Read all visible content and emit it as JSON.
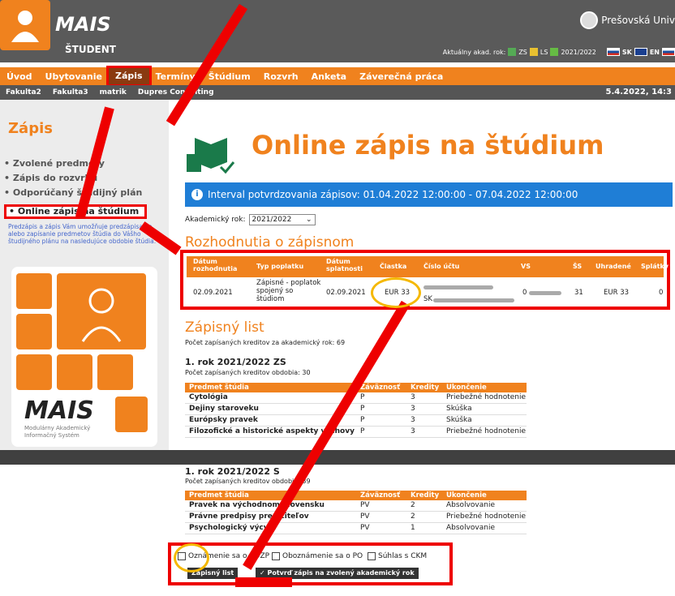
{
  "header": {
    "brand": "MAIS",
    "subbrand": "ŠTUDENT",
    "university": "Prešovská Univ",
    "year_label": "Aktuálny akad. rok:",
    "zs_label": "ZS",
    "ls_label": "LS",
    "year_value": "2021/2022",
    "lang_sk": "SK",
    "lang_en": "EN"
  },
  "menu": [
    "Úvod",
    "Ubytovanie",
    "Zápis",
    "Termíny",
    "Štúdium",
    "Rozvrh",
    "Anketa",
    "Záverečná práca"
  ],
  "active_menu": "Zápis",
  "submenu": [
    "Fakulta2",
    "Fakulta3",
    "matrik",
    "Dupres Consulting"
  ],
  "datetime": "5.4.2022, 14:3",
  "sidebar": {
    "title": "Zápis",
    "links": [
      "• Zvolené predmety",
      "• Zápis do rozvrhu",
      "• Odporúčaný študijný plán"
    ],
    "active": "• Online zápis na štúdium",
    "description": "Predzápis a zápis Vám umožňuje predzápisanie alebo zapísanie predmetov štúdia do Vášho študijného plánu na nasledujúce obdobie štúdia.",
    "logo_text": "MAIS",
    "logo_sub": "Modulárny Akademický Informačný Systém"
  },
  "page": {
    "title": "Online zápis na štúdium",
    "info": "Interval potvrdzovania zápisov: 01.04.2022 12:00:00 - 07.04.2022 12:00:00",
    "year_label": "Akademický rok:",
    "year_value": "2021/2022",
    "decisions_title": "Rozhodnutia o zápisnom",
    "list_title": "Zápisný list",
    "credits_total": "Počet zapísaných kreditov za akademický rok: 69"
  },
  "fees": {
    "headers": [
      "Dátum rozhodnutia",
      "Typ poplatku",
      "Dátum splatnosti",
      "Čiastka",
      "Číslo účtu",
      "VS",
      "ŠS",
      "Uhradené",
      "Splátky"
    ],
    "row": {
      "date": "02.09.2021",
      "type": "Zápisné - poplatok spojený so štúdiom",
      "due": "02.09.2021",
      "amount": "EUR 33",
      "account_prefix": "SK",
      "vs_prefix": "0",
      "ss": "31",
      "paid": "EUR 33",
      "installments": "0"
    }
  },
  "semesters": [
    {
      "title": "1. rok 2021/2022 ZS",
      "credits": "Počet zapísaných kreditov obdobia: 30",
      "headers": [
        "Predmet štúdia",
        "Záväznosť",
        "Kredity",
        "Ukončenie predmetu"
      ],
      "rows": [
        [
          "Cytológia",
          "P",
          "3",
          "Priebežné hodnotenie"
        ],
        [
          "Dejiny staroveku",
          "P",
          "3",
          "Skúška"
        ],
        [
          "Európsky pravek",
          "P",
          "3",
          "Skúška"
        ],
        [
          "Filozofické a historické aspekty výchovy",
          "P",
          "3",
          "Priebežné hodnotenie"
        ]
      ]
    },
    {
      "title": "1. rok 2021/2022 S",
      "credits": "Počet zapísaných kreditov obdobia: 39",
      "headers": [
        "Predmet štúdia",
        "Záväznosť",
        "Kredity",
        "Ukončenie predmetu"
      ],
      "rows": [
        [
          "Pravek na východnom Slovensku",
          "PV",
          "2",
          "Absolvovanie"
        ],
        [
          "Právne predpisy pre učiteľov",
          "PV",
          "2",
          "Priebežné hodnotenie"
        ],
        [
          "Psychologický výcvik",
          "PV",
          "1",
          "Absolvovanie"
        ]
      ]
    }
  ],
  "confirm": {
    "chk_bozp": "Oznámenie sa o BOZP",
    "chk_po": "Oboznámenie sa o PO",
    "chk_ckm": "Súhlas s CKM",
    "list_button": "Zápisný list",
    "confirm_button": "✓ Potvrď zápis na zvolený akademický rok"
  },
  "colors": {
    "accent": "#f0821e",
    "dark": "#5a5a5a",
    "info": "#1f7ed6",
    "highlight": "#e00000",
    "circle": "#f5b800"
  }
}
